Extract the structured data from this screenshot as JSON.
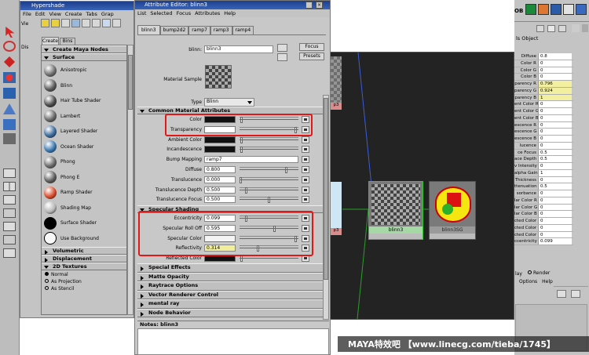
{
  "hypershade": {
    "title": "Hypershade",
    "menu": [
      "File",
      "Edit",
      "View",
      "Create",
      "Tabs",
      "Grap"
    ],
    "tabs": [
      "Create",
      "Bins"
    ],
    "create_header": "Create Maya Nodes",
    "surface_header": "Surface",
    "nodes": [
      {
        "label": "Anisotropic",
        "color": "#707070"
      },
      {
        "label": "Blinn",
        "color": "#5a5a5a"
      },
      {
        "label": "Hair Tube Shader",
        "color": "#4b4b4b"
      },
      {
        "label": "Lambert",
        "color": "#686868"
      },
      {
        "label": "Layered Shader",
        "color": "#3a6a9a"
      },
      {
        "label": "Ocean Shader",
        "color": "#3a78b0"
      },
      {
        "label": "Phong",
        "color": "#6a6a6a"
      },
      {
        "label": "Phong E",
        "color": "#5e5e5e"
      },
      {
        "label": "Ramp Shader",
        "color": "#d84a2a"
      },
      {
        "label": "Shading Map",
        "color": "#b8b8b8"
      },
      {
        "label": "Surface Shader",
        "color": "#111111"
      },
      {
        "label": "Use Background",
        "color": "#f4f4f4"
      }
    ],
    "sections": [
      "Volumetric",
      "Displacement",
      "2D Textures"
    ],
    "radios": [
      "Normal",
      "As Projection",
      "As Stencil"
    ],
    "left_label": "Vie",
    "dis_label": "Dis"
  },
  "attr_editor": {
    "title": "Attribute Editor: blinn3",
    "menu": [
      "List",
      "Selected",
      "Focus",
      "Attributes",
      "Help"
    ],
    "tabs": [
      "blinn3",
      "bump2d2",
      "ramp7",
      "ramp3",
      "ramp4"
    ],
    "name_label": "blinn:",
    "name_value": "blinn3",
    "focus_btn": "Focus",
    "presets_btn": "Presets",
    "material_sample": "Material Sample",
    "type_label": "Type",
    "type_value": "Blinn",
    "common_header": "Common Material Attributes",
    "common": [
      {
        "label": "Color",
        "kind": "swatch",
        "swatch": "#111111",
        "knob": 0.02
      },
      {
        "label": "Transparency",
        "kind": "swatch",
        "swatch": "#ffffff",
        "knob": 0.97
      },
      {
        "label": "Ambient Color",
        "kind": "swatch",
        "swatch": "#111111",
        "knob": 0.02
      },
      {
        "label": "Incandescence",
        "kind": "swatch",
        "swatch": "#111111",
        "knob": 0.02
      },
      {
        "label": "Bump Mapping",
        "kind": "text",
        "value": "ramp7"
      },
      {
        "label": "Diffuse",
        "kind": "num",
        "value": "0.800",
        "knob": 0.8
      },
      {
        "label": "Translucence",
        "kind": "num",
        "value": "0.000",
        "knob": 0.0
      },
      {
        "label": "Translucence Depth",
        "kind": "num",
        "value": "0.500",
        "knob": 0.1
      },
      {
        "label": "Translucence Focus",
        "kind": "num",
        "value": "0.500",
        "knob": 0.5
      }
    ],
    "specular_header": "Specular Shading",
    "specular": [
      {
        "label": "Eccentricity",
        "kind": "num",
        "value": "0.099",
        "knob": 0.1
      },
      {
        "label": "Specular Roll Off",
        "kind": "num",
        "value": "0.595",
        "knob": 0.6
      },
      {
        "label": "Specular Color",
        "kind": "swatch",
        "swatch": "#f4f4f4",
        "knob": 0.97
      },
      {
        "label": "Reflectivity",
        "kind": "num",
        "value": "0.314",
        "knob": 0.3,
        "highlight": true
      },
      {
        "label": "Reflected Color",
        "kind": "swatch",
        "swatch": "#111111",
        "knob": 0.02
      }
    ],
    "closed_sections": [
      "Special Effects",
      "Matte Opacity",
      "Raytrace Options",
      "Vector Renderer Control",
      "mental ray",
      "Node Behavior"
    ],
    "notes": "Notes: blinn3"
  },
  "graph": {
    "node_left_label": "p3",
    "node_left2_label": "p3",
    "blinn_label": "blinn3",
    "blinn_swatch_label": "blinn3SG"
  },
  "channel_box": {
    "title": "ls Object",
    "rows": [
      {
        "k": "Diffuse",
        "v": "0.8"
      },
      {
        "k": "Color R",
        "v": "0"
      },
      {
        "k": "Color G",
        "v": "0"
      },
      {
        "k": "Color B",
        "v": "0"
      },
      {
        "k": "parency R",
        "v": "0.796",
        "y": true
      },
      {
        "k": "parency G",
        "v": "0.924",
        "y": true
      },
      {
        "k": "parency B",
        "v": "1",
        "y": true
      },
      {
        "k": "ent Color R",
        "v": "0"
      },
      {
        "k": "ent Color G",
        "v": "0"
      },
      {
        "k": "ent Color B",
        "v": "0"
      },
      {
        "k": "escence R",
        "v": "0"
      },
      {
        "k": "escence G",
        "v": "0"
      },
      {
        "k": "escence B",
        "v": "0"
      },
      {
        "k": "lucence",
        "v": "0"
      },
      {
        "k": "ce Focus",
        "v": "0.5"
      },
      {
        "k": "ace Depth",
        "v": "0.5"
      },
      {
        "k": "v Intensity",
        "v": "0"
      },
      {
        "k": "alpha Gain",
        "v": "1"
      },
      {
        "k": "Thickness",
        "v": "0"
      },
      {
        "k": "ttenuation",
        "v": "0.5"
      },
      {
        "k": "sorbance",
        "v": "0"
      },
      {
        "k": "lar Color R",
        "v": "0"
      },
      {
        "k": "lar Color G",
        "v": "0"
      },
      {
        "k": "lar Color B",
        "v": "0"
      },
      {
        "k": "cted Color R",
        "v": "0"
      },
      {
        "k": "cted Color G",
        "v": "0"
      },
      {
        "k": "cted Color B",
        "v": "0"
      },
      {
        "k": "ccentricity",
        "v": "0.099"
      }
    ],
    "render_label": "Render",
    "layer_label": "lay",
    "bottom_menu": [
      "Options",
      "Help"
    ]
  },
  "watermark": "MAYA特效吧 【www.linecg.com/tieba/1745】",
  "colors": {
    "titlebar": "#1c3e8c",
    "highlight": "#e01818",
    "graph_bg": "#222222"
  }
}
